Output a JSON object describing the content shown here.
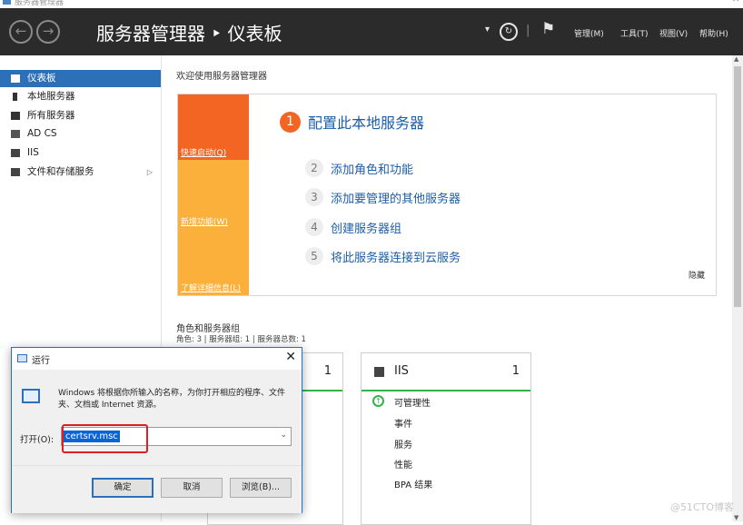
{
  "window": {
    "app_title": "服务器管理器",
    "minimize_glyph": "─",
    "close_glyph": "✕"
  },
  "header": {
    "back_glyph": "←",
    "forward_glyph": "→",
    "title": "服务器管理器 ‣ 仪表板",
    "dropdown_glyph": "▾",
    "refresh_glyph": "↻",
    "separator": "|",
    "flag_glyph": "⚑",
    "menu": [
      "管理(M)",
      "工具(T)",
      "视图(V)",
      "帮助(H)"
    ]
  },
  "sidebar": {
    "items": [
      {
        "label": "仪表板",
        "icon": "dashboard-icon",
        "active": true
      },
      {
        "label": "本地服务器",
        "icon": "server-icon"
      },
      {
        "label": "所有服务器",
        "icon": "servers-icon"
      },
      {
        "label": "AD CS",
        "icon": "adcs-icon"
      },
      {
        "label": "IIS",
        "icon": "iis-icon"
      },
      {
        "label": "文件和存储服务",
        "icon": "storage-icon",
        "has_children": true,
        "arrow": "▷"
      }
    ]
  },
  "welcome": {
    "title": "欢迎使用服务器管理器",
    "bands": [
      "快速启动(Q)",
      "新增功能(W)",
      "了解详细信息(L)"
    ],
    "steps": [
      {
        "num": "1",
        "label": "配置此本地服务器"
      },
      {
        "num": "2",
        "label": "添加角色和功能"
      },
      {
        "num": "3",
        "label": "添加要管理的其他服务器"
      },
      {
        "num": "4",
        "label": "创建服务器组"
      },
      {
        "num": "5",
        "label": "将此服务器连接到云服务"
      }
    ],
    "hide_label": "隐藏"
  },
  "roles": {
    "title": "角色和服务器组",
    "subtitle": "角色: 3 | 服务器组: 1 | 服务器总数: 1",
    "tiles": [
      {
        "name": "",
        "count": "1"
      },
      {
        "name": "IIS",
        "count": "1",
        "rows": [
          "可管理性",
          "事件",
          "服务",
          "性能",
          "BPA 结果"
        ]
      }
    ]
  },
  "scrollbar": {
    "up_glyph": "▲",
    "down_glyph": "▼"
  },
  "run_dialog": {
    "title": "运行",
    "close_glyph": "✕",
    "description": "Windows 将根据你所输入的名称，为你打开相应的程序、文件夹、文档或 Internet 资源。",
    "open_label": "打开(O):",
    "input_value": "certsrv.msc",
    "dropdown_glyph": "⌄",
    "buttons": {
      "ok": "确定",
      "cancel": "取消",
      "browse": "浏览(B)..."
    }
  },
  "watermark": "@51CTO博客",
  "colors": {
    "header_bg": "#2b2b2b",
    "accent_blue": "#2e70b8",
    "quickstart_orange": "#f26522",
    "band_yellow": "#fbb03b",
    "status_green": "#35b34a",
    "highlight_red": "#e02020"
  }
}
